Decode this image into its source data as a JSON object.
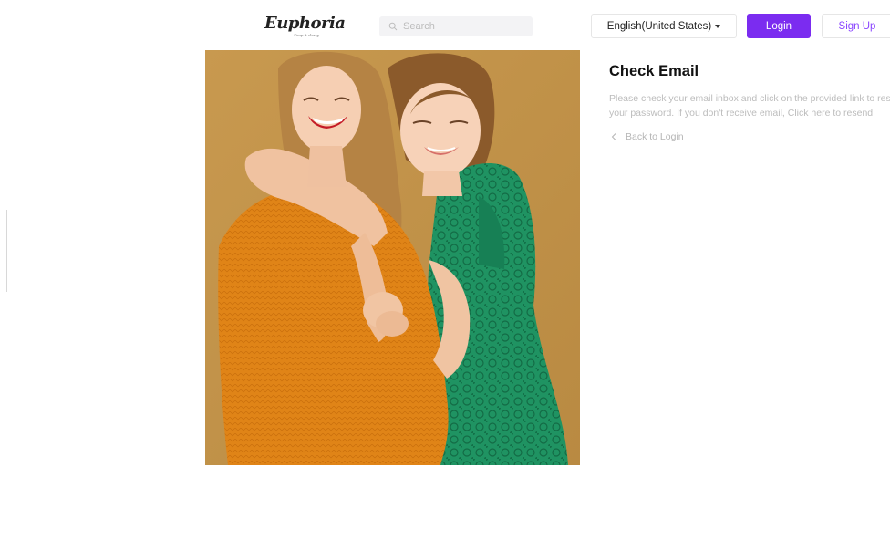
{
  "header": {
    "logo_text": "Euphoria",
    "logo_tagline": "Keep it classy",
    "search": {
      "placeholder": "Search",
      "value": ""
    },
    "language": "English(United States)",
    "login_label": "Login",
    "signup_label": "Sign Up"
  },
  "content": {
    "title": "Check Email",
    "message": "Please check your email inbox and click on the provided link to reset your password. If you don't receive email, Click here to resend",
    "back_label": "Back to Login"
  },
  "colors": {
    "accent": "#7b2cf0",
    "signup_text": "#8a45ff",
    "hero_background": "#c1924a",
    "sweater": "#e08417",
    "dress": "#1f9362"
  },
  "icons": {
    "search": "search-icon",
    "language_caret": "caret-down-icon",
    "back": "chevron-left-icon"
  }
}
